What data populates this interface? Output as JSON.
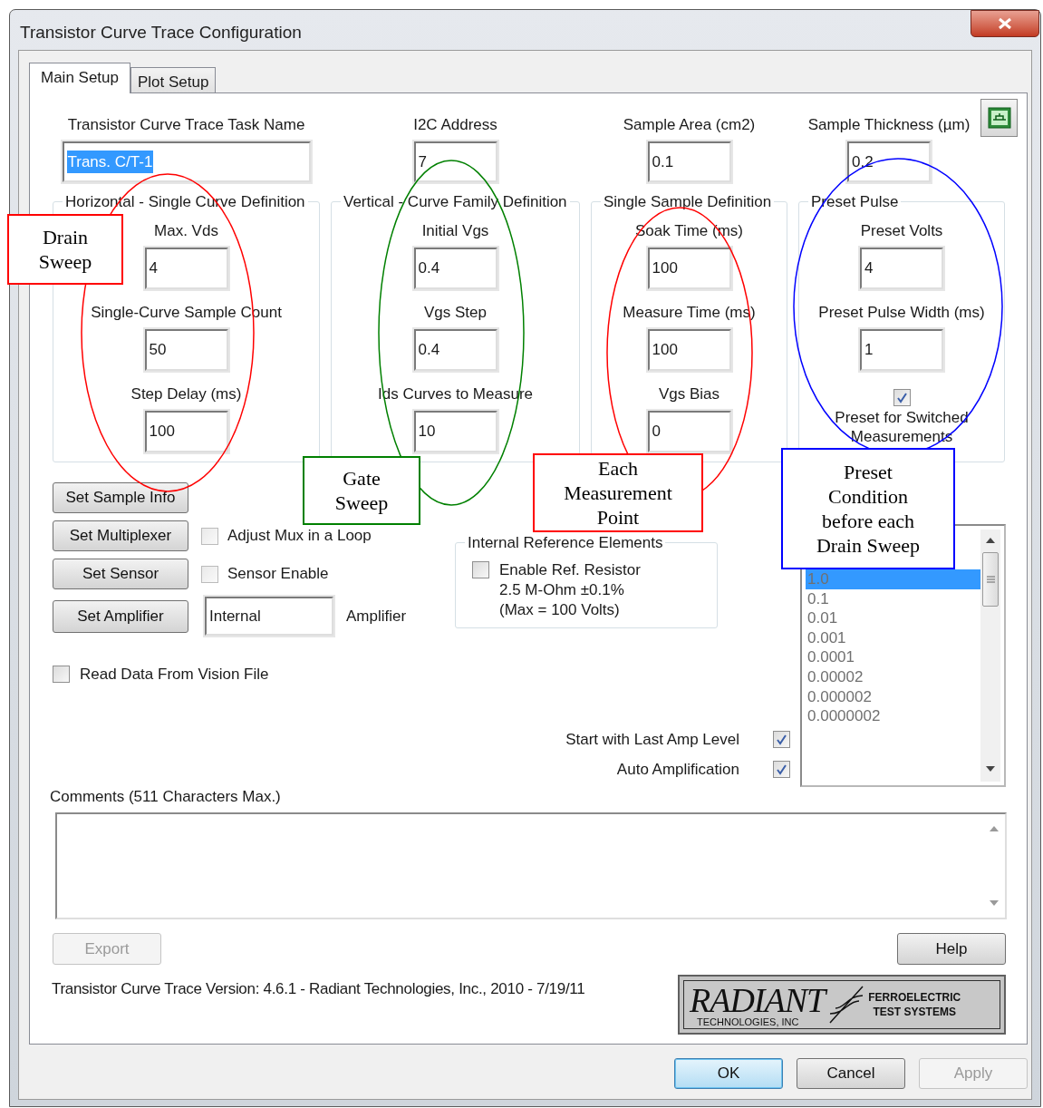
{
  "window": {
    "title": "Transistor Curve Trace Configuration"
  },
  "tabs": [
    {
      "label": "Main Setup",
      "selected": true
    },
    {
      "label": "Plot Setup",
      "selected": false
    }
  ],
  "top_fields": [
    {
      "label": "Transistor Curve Trace Task Name",
      "value": "Trans. C/T-1",
      "text_selected": true
    },
    {
      "label": "I2C Address",
      "value": "7",
      "text_selected": false
    },
    {
      "label": "Sample Area (cm2)",
      "value": "0.1",
      "text_selected": false
    },
    {
      "label": "Sample Thickness (µm)",
      "value": "0.2",
      "text_selected": false
    }
  ],
  "groups": [
    {
      "title": "Horizontal - Single Curve Definition",
      "items": [
        {
          "kind": "field",
          "label": "Max. Vds",
          "value": "4"
        },
        {
          "kind": "field",
          "label": "Single-Curve Sample Count",
          "value": "50"
        },
        {
          "kind": "field",
          "label": "Step Delay (ms)",
          "value": "100"
        }
      ]
    },
    {
      "title": "Vertical - Curve Family Definition",
      "items": [
        {
          "kind": "field",
          "label": "Initial Vgs",
          "value": "0.4"
        },
        {
          "kind": "field",
          "label": "Vgs Step",
          "value": "0.4"
        },
        {
          "kind": "field",
          "label": "Ids Curves to Measure",
          "value": "10"
        }
      ]
    },
    {
      "title": "Single Sample Definition",
      "items": [
        {
          "kind": "field",
          "label": "Soak Time (ms)",
          "value": "100"
        },
        {
          "kind": "field",
          "label": "Measure Time (ms)",
          "value": "100"
        },
        {
          "kind": "field",
          "label": "Vgs Bias",
          "value": "0"
        }
      ]
    },
    {
      "title": "Preset Pulse",
      "items": [
        {
          "kind": "field",
          "label": "Preset Volts",
          "value": "4"
        },
        {
          "kind": "field",
          "label": "Preset Pulse Width (ms)",
          "value": "1"
        },
        {
          "kind": "checkbox",
          "label": "Preset for Switched Measurements",
          "checked": true
        }
      ]
    }
  ],
  "button_rows": [
    {
      "button": "Set Sample Info"
    },
    {
      "button": "Set Multiplexer",
      "checkbox": {
        "label": "Adjust Mux in a Loop",
        "checked": false
      }
    },
    {
      "button": "Set Sensor",
      "checkbox": {
        "label": "Sensor Enable",
        "checked": false
      }
    },
    {
      "button": "Set Amplifier",
      "field": {
        "value": "Internal",
        "label": "Amplifier"
      }
    }
  ],
  "read_data_checkbox": {
    "label": "Read Data From Vision File",
    "checked": false
  },
  "reference_group": {
    "title": "Internal Reference Elements",
    "checkbox": {
      "label": "Enable Ref. Resistor",
      "checked": false
    },
    "details": [
      "2.5 M-Ohm ±0.1%",
      "(Max = 100 Volts)"
    ]
  },
  "amp_options": [
    {
      "label": "Start with Last Amp Level",
      "checked": true
    },
    {
      "label": "Auto Amplification",
      "checked": true
    }
  ],
  "amp_list": [
    {
      "label": "1.0",
      "selected": true
    },
    {
      "label": "0.1",
      "selected": false
    },
    {
      "label": "0.01",
      "selected": false
    },
    {
      "label": "0.001",
      "selected": false
    },
    {
      "label": "0.0001",
      "selected": false
    },
    {
      "label": "0.00002",
      "selected": false
    },
    {
      "label": "0.000002",
      "selected": false
    },
    {
      "label": "0.0000002",
      "selected": false
    }
  ],
  "comments": {
    "label": "Comments (511 Characters Max.)"
  },
  "export_button": {
    "label": "Export",
    "disabled": true
  },
  "help_button": {
    "label": "Help"
  },
  "version": "Transistor Curve Trace Version: 4.6.1 - Radiant Technologies, Inc., 2010 - 7/19/11",
  "logo": {
    "name": "RADIANT",
    "subtitle": "TECHNOLOGIES, INC",
    "tagline": [
      "FERROELECTRIC",
      "TEST SYSTEMS"
    ]
  },
  "dialog_buttons": [
    {
      "label": "OK",
      "default": true,
      "disabled": false
    },
    {
      "label": "Cancel",
      "default": false,
      "disabled": false
    },
    {
      "label": "Apply",
      "default": false,
      "disabled": true
    }
  ],
  "annotations": [
    {
      "text": "Drain Sweep",
      "color": "#ff0000"
    },
    {
      "text": "Gate Sweep",
      "color": "#008000"
    },
    {
      "text": "Each Measurement Point",
      "color": "#ff0000"
    },
    {
      "text": "Preset Condition before each Drain Sweep",
      "color": "#0000ff"
    }
  ]
}
